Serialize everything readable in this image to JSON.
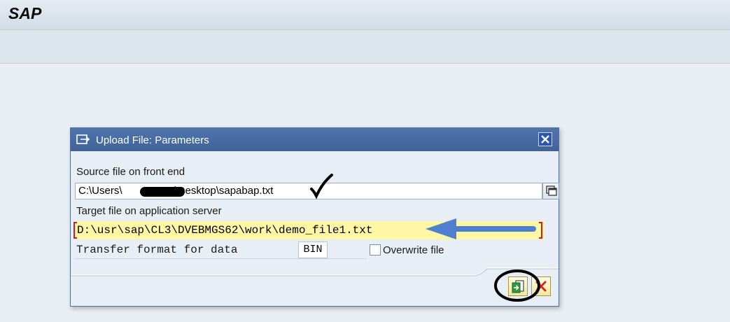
{
  "app": {
    "title": "SAP"
  },
  "dialog": {
    "title": "Upload File: Parameters",
    "source": {
      "label": "Source file on front end",
      "value_prefix": "C:\\Users\\",
      "value_suffix": "\\Desktop\\sapabap.txt"
    },
    "target": {
      "label": "Target file on application server",
      "value": "D:\\usr\\sap\\CL3\\DVEBMGS62\\work\\demo_file1.txt"
    },
    "format": {
      "label": "Transfer format for data",
      "value": "BIN"
    },
    "overwrite": {
      "label": "Overwrite file",
      "checked": false
    }
  },
  "colors": {
    "header_blue": "#4a6fa5",
    "highlight_yellow": "#fff6a6",
    "required_red": "#d21c1c",
    "annotation_arrow": "#4f7fcf"
  },
  "icons": {
    "dialog": "upload-dialog-icon",
    "close": "close-icon",
    "f4": "value-help-icon",
    "ok": "execute-icon",
    "cancel": "cancel-x-icon"
  }
}
